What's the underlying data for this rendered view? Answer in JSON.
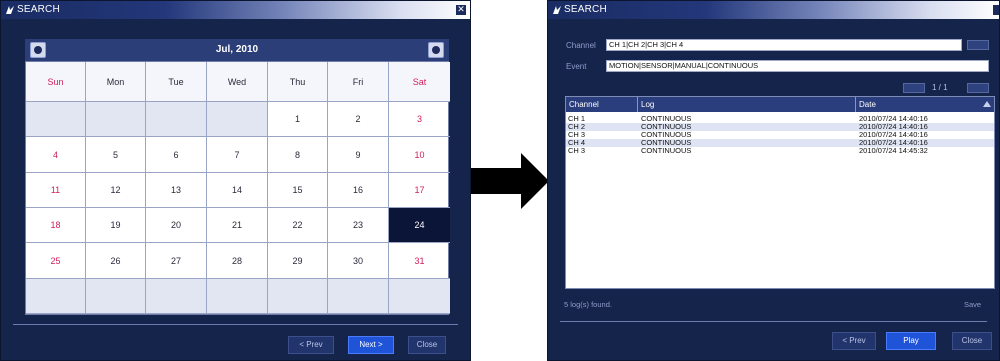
{
  "left_window": {
    "title": "SEARCH",
    "calendar": {
      "month_label": "Jul, 2010",
      "weekdays": [
        "Sun",
        "Mon",
        "Tue",
        "Wed",
        "Thu",
        "Fri",
        "Sat"
      ],
      "weeks": [
        [
          "",
          "",
          "",
          "",
          "1",
          "2",
          "3"
        ],
        [
          "4",
          "5",
          "6",
          "7",
          "8",
          "9",
          "10"
        ],
        [
          "11",
          "12",
          "13",
          "14",
          "15",
          "16",
          "17"
        ],
        [
          "18",
          "19",
          "20",
          "21",
          "22",
          "23",
          "24"
        ],
        [
          "25",
          "26",
          "27",
          "28",
          "29",
          "30",
          "31"
        ],
        [
          "",
          "",
          "",
          "",
          "",
          "",
          ""
        ]
      ],
      "selected_day": "24"
    },
    "buttons": {
      "prev": "< Prev",
      "next": "Next >",
      "close": "Close"
    }
  },
  "right_window": {
    "title": "SEARCH",
    "channel_label": "Channel",
    "channel_value": "CH 1|CH 2|CH 3|CH 4",
    "event_label": "Event",
    "event_value": "MOTION|SENSOR|MANUAL|CONTINUOUS",
    "page_indicator": "1 / 1",
    "columns": [
      "Channel",
      "Log",
      "Date"
    ],
    "rows": [
      {
        "channel": "CH 1",
        "log": "CONTINUOUS",
        "date": "2010/07/24 14:40:16"
      },
      {
        "channel": "CH 2",
        "log": "CONTINUOUS",
        "date": "2010/07/24 14:40:16"
      },
      {
        "channel": "CH 3",
        "log": "CONTINUOUS",
        "date": "2010/07/24 14:40:16"
      },
      {
        "channel": "CH 4",
        "log": "CONTINUOUS",
        "date": "2010/07/24 14:40:16"
      },
      {
        "channel": "CH 3",
        "log": "CONTINUOUS",
        "date": "2010/07/24 14:45:32"
      }
    ],
    "status": "5 log(s) found.",
    "save_label": "Save",
    "buttons": {
      "prev": "< Prev",
      "play": "Play",
      "close": "Close"
    }
  },
  "colors": {
    "window_bg": "#15244a",
    "weekend_red": "#d0205a",
    "selected_day_bg": "#0b1538",
    "primary_button": "#1f53d8"
  },
  "icons": [
    "window-icon",
    "close-icon",
    "prev-month-icon",
    "next-month-icon",
    "right-arrow-icon",
    "sort-icon"
  ]
}
